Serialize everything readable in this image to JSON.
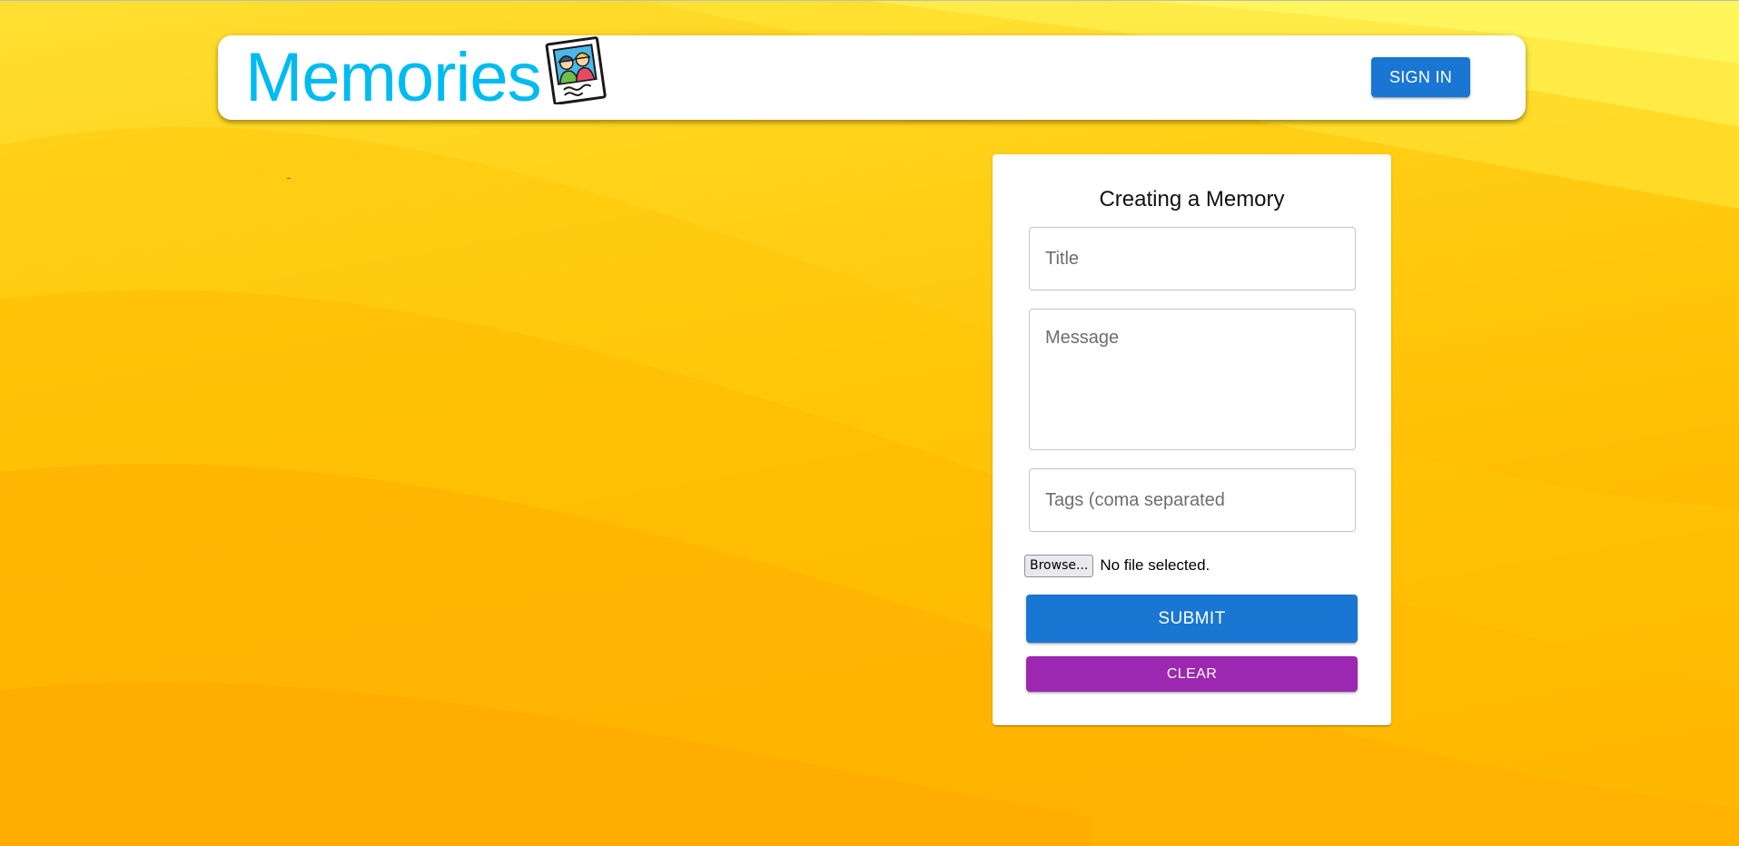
{
  "header": {
    "brand_text": "Memories",
    "brand_icon": "photo-memories-icon",
    "signin_label": "SIGN IN"
  },
  "form": {
    "heading": "Creating a Memory",
    "title_placeholder": "Title",
    "message_placeholder": "Message",
    "tags_placeholder": "Tags (coma separated",
    "browse_label": "Browse...",
    "file_status": "No file selected.",
    "submit_label": "SUBMIT",
    "clear_label": "CLEAR"
  },
  "colors": {
    "brand_text": "#00bbf0",
    "primary_button": "#1976d2",
    "secondary_button": "#9c27b0",
    "background_light": "#ffe033",
    "background_dark": "#ffab00"
  }
}
